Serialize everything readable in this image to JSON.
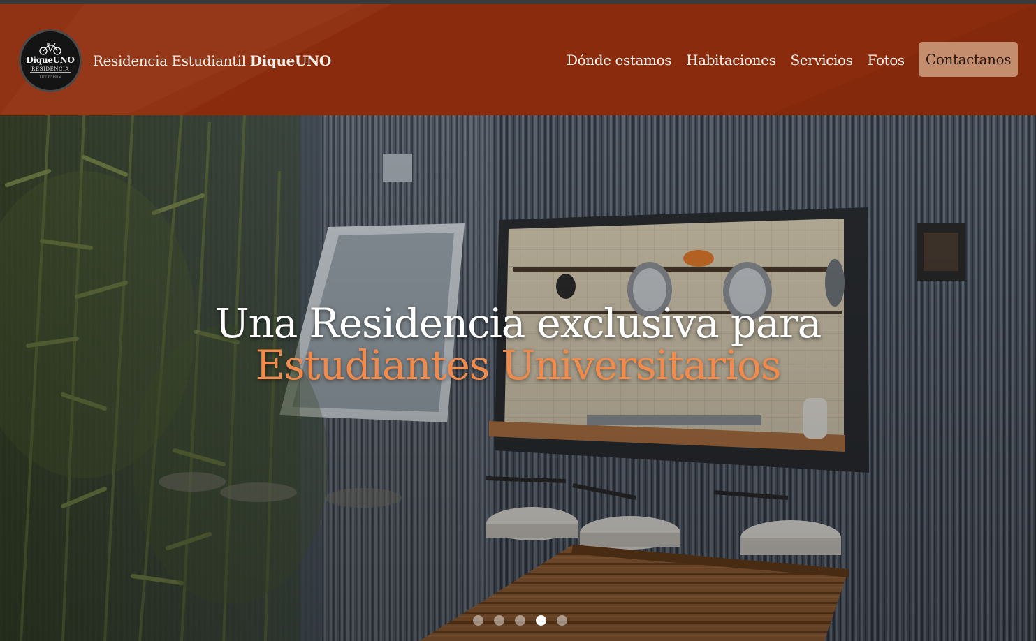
{
  "brand": {
    "logo_name": "DiqueUNO",
    "logo_sub": "RESIDENCIA",
    "logo_foot": "LET IT RUN",
    "title_prefix": "Residencia Estudiantil",
    "title_bold": "DiqueUNO"
  },
  "nav": {
    "items": [
      {
        "label": "Dónde estamos"
      },
      {
        "label": "Habitaciones"
      },
      {
        "label": "Servicios"
      },
      {
        "label": "Fotos"
      }
    ],
    "cta_label": "Contactanos"
  },
  "hero": {
    "title": "Una Residencia exclusiva para",
    "subtitle": "Estudiantes Universitarios",
    "slide_count": 5,
    "active_slide_index": 3
  },
  "colors": {
    "header_bg": "#8a2b0e",
    "cta_bg": "#c48d6e",
    "accent_text": "#f08b4d"
  },
  "icons": [
    "bicycle-icon"
  ]
}
